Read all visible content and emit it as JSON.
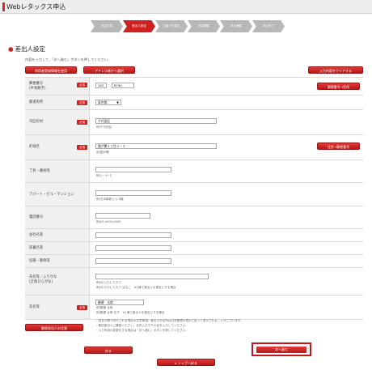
{
  "header": {
    "title": "Webレタックス申込"
  },
  "steps": [
    {
      "label": "内容作成"
    },
    {
      "label": "差出人設定"
    },
    {
      "label": "お届け先設定"
    },
    {
      "label": "内容確認"
    },
    {
      "label": "申込確認"
    },
    {
      "label": "申込完了"
    }
  ],
  "page": {
    "section_title": "差出人設定",
    "intro": "内容を入力して、「次へ進む」ボタンを押してください。"
  },
  "actions": {
    "use_registered": "利用者登録情報を使用",
    "address_book": "アドレス帳から選択",
    "clear_all": "入力内容をクリアする",
    "zip_search": "郵便番号→住所",
    "address_search": "住所→郵便番号",
    "guide": "郵便差出人の注意",
    "back": "戻る",
    "next": "次へ進む",
    "cancel": "トップへ戻る"
  },
  "form": {
    "required_label": "必須",
    "postal": {
      "label": "郵便番号",
      "sublabel": "(半角数字)",
      "part1": "163",
      "part2": "8790"
    },
    "prefecture": {
      "label": "都道府県",
      "value": "東京都"
    },
    "city": {
      "label": "市区町村",
      "value": "千代田区",
      "hint": "例)千代田区"
    },
    "town": {
      "label": "町域名",
      "value": "霞が関１丁目３－２",
      "hint": "例)霞が関"
    },
    "chome": {
      "label": "丁目・番地等",
      "value": "",
      "hint": "例)1－3－2"
    },
    "building": {
      "label": "アパート・ビル・マンション",
      "value": "",
      "hint": "例)日本郵政ビル 8階"
    },
    "phone": {
      "label": "電話番号",
      "value": "",
      "hint": "例)03-0000-0000"
    },
    "company": {
      "label": "会社名等",
      "value": ""
    },
    "department": {
      "label": "部署名等",
      "value": ""
    },
    "position": {
      "label": "役職・敬称等",
      "value": ""
    },
    "kana": {
      "label": "氏名等／ふりがな",
      "sublabel": "(全角ひらがな)",
      "value": "",
      "hint1": "例)ゆうびん たろう",
      "hint2": "例)ゆうびん たろう はなこ　※1通で差出人を連名にする場合"
    },
    "name": {
      "label": "氏名等",
      "value": "郵便　太郎",
      "hint1": "例)郵便 太郎",
      "hint2": "例)郵便 太郎 花子　※1通で差出人を連名にする場合"
    }
  },
  "notes": {
    "line1": "・姓名の間で改行される場合の注意事項。差出人の住所は日本郵便の表示に従って表示されることがございます。",
    "line2": "・郵送差出人ご確認ください。住所入力でその旨を入力してください。",
    "line3": "・入力内容の変更をする場合は「次へ進む」ボタンを押してください。"
  }
}
